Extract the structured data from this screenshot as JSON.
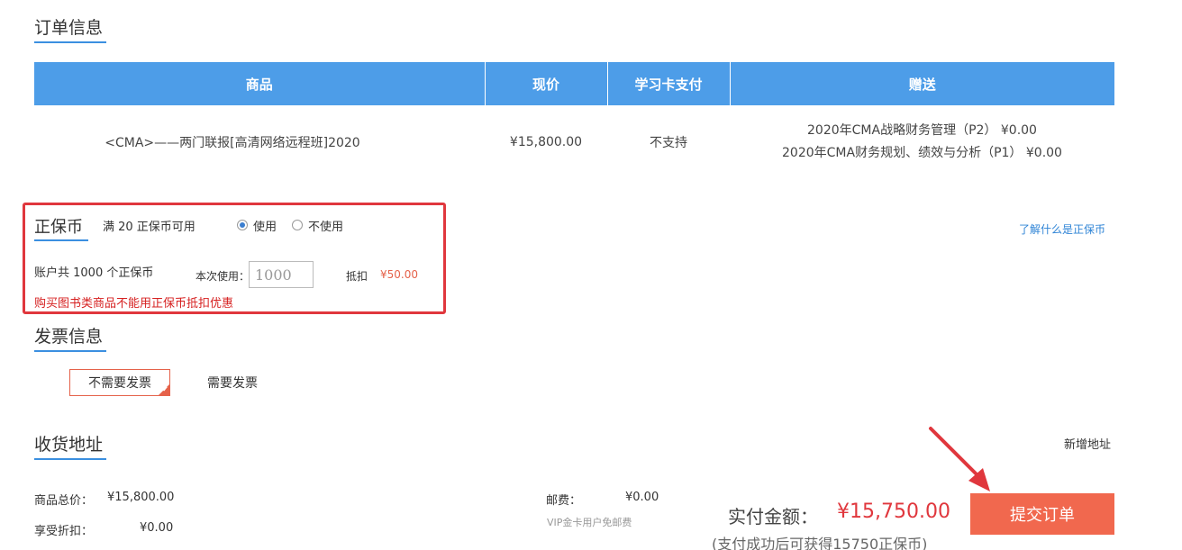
{
  "order_info": {
    "title": "订单信息",
    "headers": [
      "商品",
      "现价",
      "学习卡支付",
      "赠送"
    ],
    "row": {
      "product": "<CMA>——两门联报[高清网络远程班]2020",
      "price": "¥15,800.00",
      "card_pay": "不支持",
      "gifts": [
        "2020年CMA战略财务管理（P2） ¥0.00",
        "2020年CMA财务规划、绩效与分析（P1） ¥0.00"
      ]
    }
  },
  "coins": {
    "title": "正保币",
    "condition": "满 20 正保币可用",
    "use_label": "使用",
    "not_use_label": "不使用",
    "selected": "use",
    "account_text": "账户共 1000 个正保币",
    "this_use_label": "本次使用：",
    "input_value": "1000",
    "deduct_label": "抵扣",
    "deduct_value": "¥50.00",
    "warning": "购买图书类商品不能用正保币抵扣优惠",
    "learn_link": "了解什么是正保币"
  },
  "invoice": {
    "title": "发票信息",
    "options": [
      "不需要发票",
      "需要发票"
    ],
    "selected": "不需要发票"
  },
  "address": {
    "title": "收货地址",
    "add_link": "新增地址"
  },
  "summary": {
    "total_label": "商品总价：",
    "total_value": "¥15,800.00",
    "discount_label": "享受折扣：",
    "discount_value": "¥0.00",
    "postage_label": "邮费：",
    "postage_value": "¥0.00",
    "vip_note": "VIP金卡用户免邮费",
    "pay_label": "实付金额：",
    "pay_value": "¥15,750.00",
    "reward_note": "(支付成功后可获得15750正保币)",
    "submit_label": "提交订单"
  },
  "colors": {
    "header_blue": "#4d9de8",
    "accent_red": "#e0373d",
    "button_orange": "#f1684e"
  }
}
